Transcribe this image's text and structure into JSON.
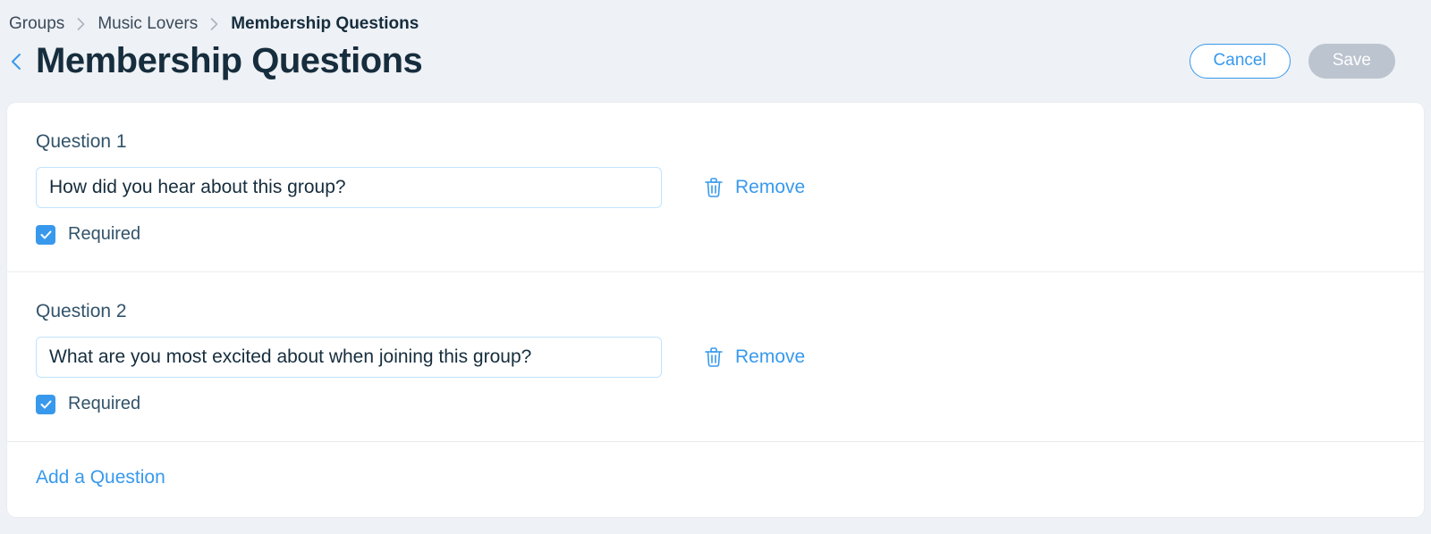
{
  "breadcrumb": {
    "items": [
      {
        "label": "Groups"
      },
      {
        "label": "Music Lovers"
      },
      {
        "label": "Membership Questions"
      }
    ]
  },
  "header": {
    "title": "Membership Questions",
    "cancel_label": "Cancel",
    "save_label": "Save"
  },
  "questions": [
    {
      "label": "Question 1",
      "value": "How did you hear about this group?",
      "remove_label": "Remove",
      "required_label": "Required",
      "required_checked": true
    },
    {
      "label": "Question 2",
      "value": "What are you most excited about when joining this group?",
      "remove_label": "Remove",
      "required_label": "Required",
      "required_checked": true
    }
  ],
  "footer": {
    "add_label": "Add a Question"
  },
  "colors": {
    "accent": "#3899ec",
    "text_primary": "#162d3d",
    "text_secondary": "#32536a",
    "page_bg": "#eef1f5",
    "save_disabled_bg": "#bcc4cf"
  }
}
